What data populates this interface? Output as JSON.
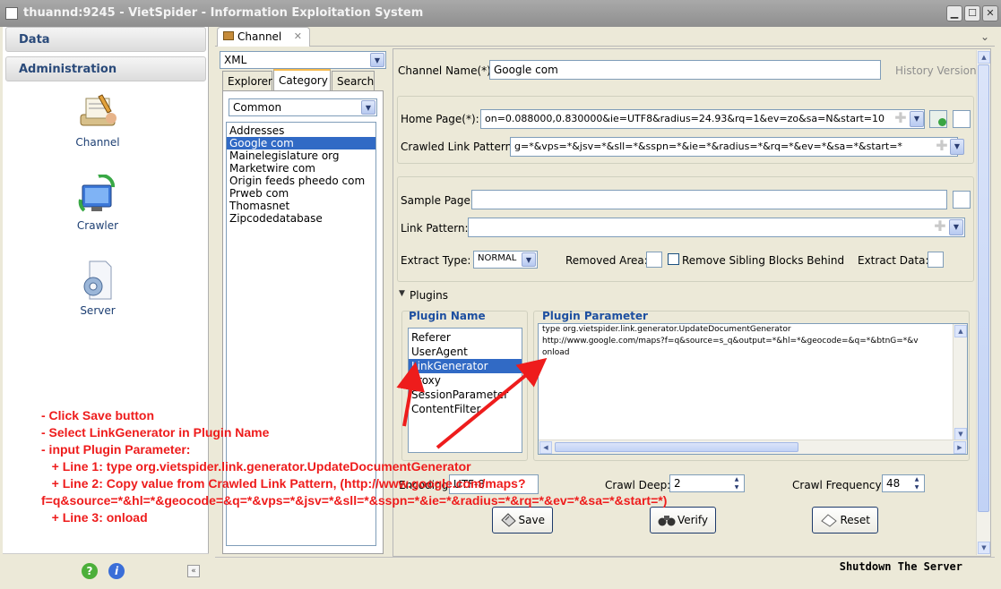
{
  "window": {
    "title": "thuannd:9245 - VietSpider - Information Exploitation System"
  },
  "nav": {
    "sections": [
      "Data",
      "Administration"
    ],
    "tools": [
      {
        "label": "Channel",
        "icon": "channel-icon"
      },
      {
        "label": "Crawler",
        "icon": "crawler-icon"
      },
      {
        "label": "Server",
        "icon": "server-icon"
      }
    ]
  },
  "tab": {
    "label": "Channel"
  },
  "left_panel": {
    "source_combo": "XML",
    "subtabs": [
      "Explorer",
      "Category",
      "Search"
    ],
    "active_subtab": "Category",
    "category_combo": "Common",
    "categories": [
      "Addresses",
      "Google com",
      "Mainelegislature org",
      "Marketwire com",
      "Origin feeds pheedo com",
      "Prweb com",
      "Thomasnet",
      "Zipcodedatabase"
    ],
    "selected_category": "Google com"
  },
  "form": {
    "channel_name_label": "Channel Name(*):",
    "channel_name_value": "Google com",
    "history_version": "History Version",
    "home_page_label": "Home Page(*):",
    "home_page_value": "on=0.088000,0.830000&ie=UTF8&radius=24.93&rq=1&ev=zo&sa=N&start=10",
    "crawled_link_label": "Crawled Link Pattern:",
    "crawled_link_value": "g=*&vps=*&jsv=*&sll=*&sspn=*&ie=*&radius=*&rq=*&ev=*&sa=*&start=*",
    "sample_page_label": "Sample Page:",
    "sample_page_value": "",
    "link_pattern_label": "Link Pattern:",
    "link_pattern_value": "",
    "extract_type_label": "Extract Type:",
    "extract_type_value": "NORMAL",
    "removed_area_label": "Removed Area:",
    "remove_sibling_label": "Remove Sibling Blocks Behind",
    "extract_data_label": "Extract Data:",
    "plugins_label": "Plugins",
    "plugin_name_header": "Plugin Name",
    "plugin_param_header": "Plugin Parameter",
    "plugins": [
      "Referer",
      "UserAgent",
      "LinkGenerator",
      "Proxy",
      "SessionParameter",
      "ContentFilter"
    ],
    "selected_plugin": "LinkGenerator",
    "param_lines": [
      "type org.vietspider.link.generator.UpdateDocumentGenerator",
      "http://www.google.com/maps?f=q&source=s_q&output=*&hl=*&geocode=&q=*&btnG=*&v",
      "onload"
    ],
    "encoding_label": "Encoding:",
    "encoding_value": "UTF-8",
    "crawl_deep_label": "Crawl Deep:",
    "crawl_deep_value": "2",
    "crawl_freq_label": "Crawl Frequency:",
    "crawl_freq_value": "48",
    "save": "Save",
    "verify": "Verify",
    "reset": "Reset"
  },
  "status": {
    "shutdown": "Shutdown The Server"
  },
  "annotation": {
    "color": "#ee1c1c",
    "lines": [
      "- Click Save button",
      "- Select LinkGenerator in Plugin Name",
      "- input Plugin Parameter:",
      "   + Line 1: type org.vietspider.link.generator.UpdateDocumentGenerator",
      "   + Line 2: Copy value from Crawled Link Pattern, (http://www.google.com/maps?",
      "f=q&source=*&hl=*&geocode=&q=*&vps=*&jsv=*&sll=*&sspn=*&ie=*&radius=*&rq=*&ev=*&sa=*&start=*)",
      "   + Line 3: onload"
    ]
  }
}
